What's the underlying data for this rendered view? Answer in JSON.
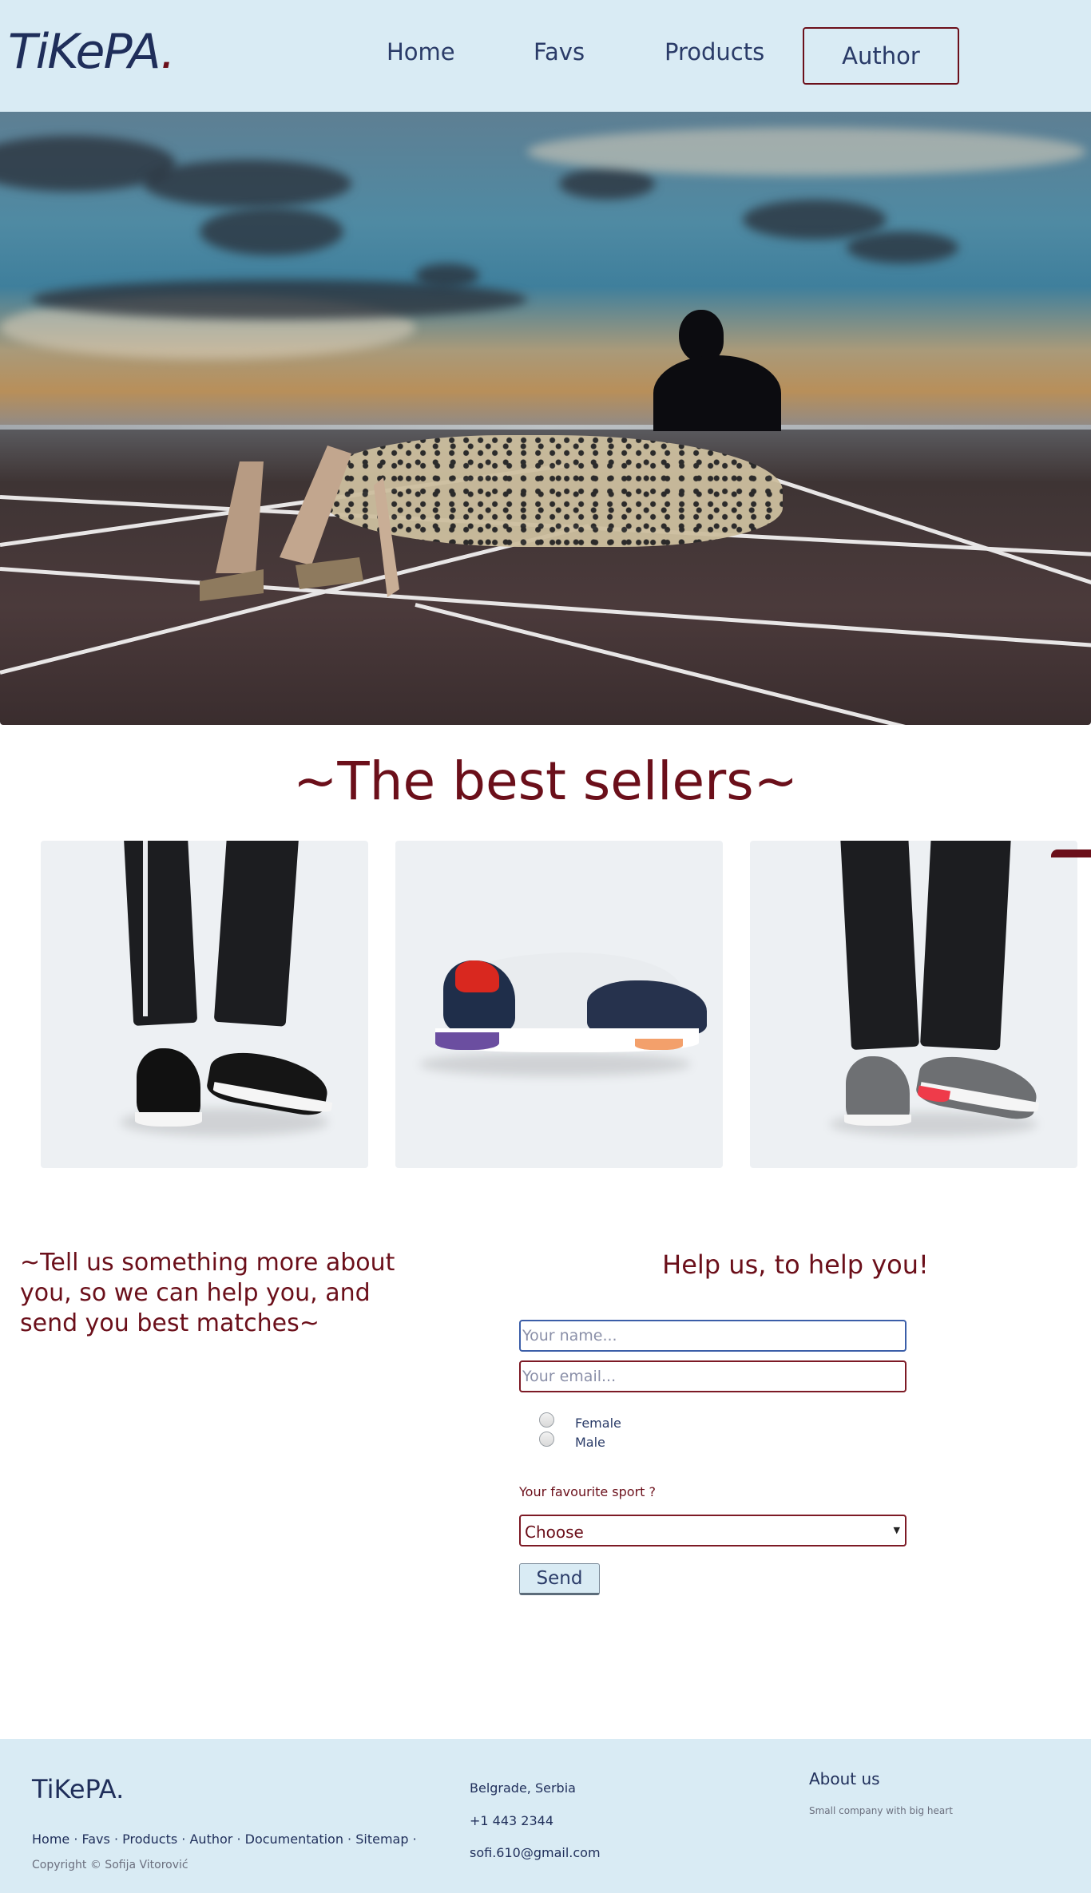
{
  "header": {
    "logo": "TiKePA",
    "logo_dot": ".",
    "nav": [
      "Home",
      "Favs",
      "Products"
    ],
    "nav_button": "Author"
  },
  "hero": {
    "icon": "hero-runner-cheetah-image"
  },
  "bestsellers": {
    "title": "~The best sellers~",
    "cards": [
      {
        "icon": "black-sneakers-image"
      },
      {
        "icon": "retro-sneaker-image"
      },
      {
        "icon": "grey-sneakers-image"
      }
    ]
  },
  "form": {
    "left_text": "~Tell us something more about you, so we can help you, and send you best matches~",
    "title": "Help us, to help you!",
    "name_placeholder": "Your name...",
    "email_placeholder": "Your email...",
    "gender_options": [
      "Female",
      "Male"
    ],
    "sport_question": "Your favourite sport ?",
    "sport_selected": "Choose",
    "send_label": "Send"
  },
  "footer": {
    "logo": "TiKePA.",
    "links": [
      "Home",
      "Favs",
      "Products",
      "Author",
      "Documentation",
      "Sitemap"
    ],
    "separator": " · ",
    "copyright": "Copyright © Sofija Vitorović",
    "address": "Belgrade, Serbia",
    "phone": "+1 443 2344",
    "email": "sofi.610@gmail.com",
    "about_title": "About us",
    "about_text": "Small company with big heart"
  },
  "colors": {
    "header_bg": "#d9ebf4",
    "accent": "#6b0f1a",
    "navy": "#1f2e5a"
  }
}
